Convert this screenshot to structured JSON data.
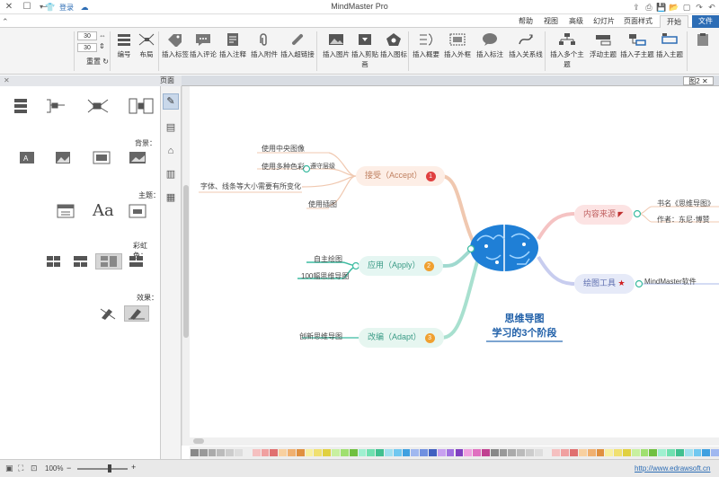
{
  "app": {
    "title": "MindMaster Pro",
    "quick_label": "登录"
  },
  "tabs": [
    {
      "id": "file",
      "label": "文件"
    },
    {
      "id": "home",
      "label": "开始"
    },
    {
      "id": "page_style",
      "label": "页面样式"
    },
    {
      "id": "slides",
      "label": "幻灯片"
    },
    {
      "id": "advanced",
      "label": "高级"
    },
    {
      "id": "view",
      "label": "视图"
    },
    {
      "id": "help",
      "label": "帮助"
    }
  ],
  "ribbon": {
    "buttons": [
      {
        "label": "插入主题"
      },
      {
        "label": "插入子主题"
      },
      {
        "label": "浮动主题"
      },
      {
        "label": "插入多个主题"
      },
      {
        "label": "插入关系线"
      },
      {
        "label": "插入标注"
      },
      {
        "label": "插入外框"
      },
      {
        "label": "插入概要"
      },
      {
        "label": "插入图标"
      },
      {
        "label": "插入剪贴画"
      },
      {
        "label": "插入图片"
      },
      {
        "label": "插入超链接"
      },
      {
        "label": "插入附件"
      },
      {
        "label": "插入注释"
      },
      {
        "label": "插入评论"
      },
      {
        "label": "插入标签"
      }
    ],
    "layout_label": "布局",
    "numbering_label": "编号",
    "spacing_a": "30",
    "spacing_b": "30",
    "reset_label": "重置"
  },
  "doc_tab": "图2",
  "panel": {
    "header": "页面",
    "sections": {
      "background": "背景：",
      "theme": "主题：",
      "rainbow": "彩虹色：",
      "effects": "效果："
    },
    "theme_text_sample": "Aa"
  },
  "mindmap": {
    "center_title_line1": "思维导图",
    "center_title_line2": "学习的3个阶段",
    "branches": [
      {
        "label": "接受（Accept）",
        "num": "1",
        "color": "#f0c8b0",
        "bg": "#fdeee6"
      },
      {
        "label": "应用（Apply）",
        "num": "2",
        "color": "#9fd9cf",
        "bg": "#e5f6f2"
      },
      {
        "label": "改编（Adapt）",
        "num": "3",
        "color": "#a8e0cf",
        "bg": "#e6f6f0"
      }
    ],
    "accept_subs": [
      "使用中央图像",
      "使用多种色彩",
      "字体、线条等大小需要有所变化",
      "使用插图"
    ],
    "accept_subs_top": [
      "使用中央图像",
      "遵守层级"
    ],
    "apply_subs": [
      "自主绘图",
      "100幅思维导图"
    ],
    "adapt_subs": [
      "创新思维导图"
    ],
    "right_top": {
      "label": "内容来源",
      "subs": [
        "书名《思维导图》",
        "作者：东尼·博赞"
      ]
    },
    "right_bottom": {
      "label": "绘图工具",
      "subs": [
        "MindMaster软件"
      ]
    }
  },
  "status": {
    "url": "http://www.edrawsoft.cn",
    "zoom": "100%"
  },
  "colors": {
    "file_tab": "#2d6db5",
    "brain": "#1f7fd6",
    "accent_red": "#e04040"
  }
}
